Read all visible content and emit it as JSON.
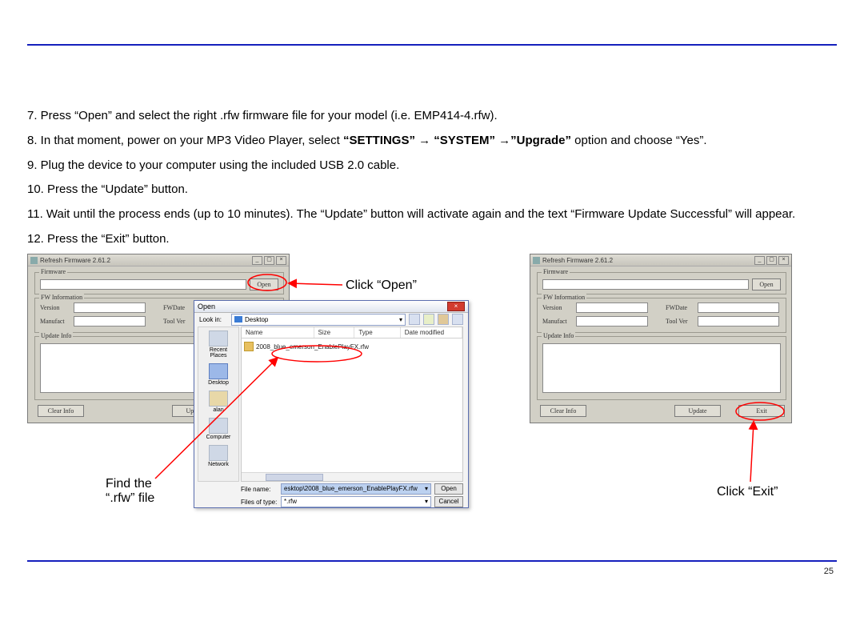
{
  "page_number": "25",
  "step7": "7. Press “Open” and select the right .rfw firmware file for your model (i.e. EMP414-4.rfw).",
  "step8_pre": "8. In that moment, power on your MP3 Video Player, select ",
  "step8_b1": "“SETTINGS”",
  "step8_arrow": " → ",
  "step8_b2": "“SYSTEM”",
  "step8_arrow2": " →",
  "step8_b3": "”Upgrade”",
  "step8_post": " option and choose “Yes”.",
  "step9": "9. Plug the device to your computer using the included USB 2.0 cable.",
  "step10": "10. Press the “Update” button.",
  "step11": "11. Wait until the process ends (up to 10 minutes).  The “Update” button will activate again and the text “Firmware Update Successful” will appear.",
  "step12": "12. Press the “Exit” button.",
  "scr_title": "Refresh Firmware 2.61.2",
  "grp_firmware": "Firmware",
  "grp_fwinfo": "FW Information",
  "grp_update": "Update Info",
  "lbl_version": "Version",
  "lbl_fwdate": "FWDate",
  "lbl_manufact": "Manufact",
  "lbl_toolver": "Tool Ver",
  "btn_open": "Open",
  "btn_clear": "Clear Info",
  "btn_update": "Update",
  "btn_exit": "Exit",
  "dlg_title": "Open",
  "dlg_lookin_lbl": "Look in:",
  "dlg_lookin_val": "Desktop",
  "side_recent": "Recent Places",
  "side_desktop": "Desktop",
  "side_alan": "alan",
  "side_computer": "Computer",
  "side_network": "Network",
  "col_name": "Name",
  "col_size": "Size",
  "col_type": "Type",
  "col_date": "Date modified",
  "file_entry": "2008_blue_emerson_EnablePlayFX.rfw",
  "dlg_filename_lbl": "File name:",
  "dlg_filename_val": "esktop\\2008_blue_emerson_EnablePlayFX.rfw",
  "dlg_filetype_lbl": "Files of type:",
  "dlg_filetype_val": "*.rfw",
  "dlg_btn_open": "Open",
  "dlg_btn_cancel": "Cancel",
  "callout_open": "Click “Open”",
  "callout_find1": "Find the",
  "callout_find2": "“.rfw” file",
  "callout_exit": "Click “Exit”"
}
